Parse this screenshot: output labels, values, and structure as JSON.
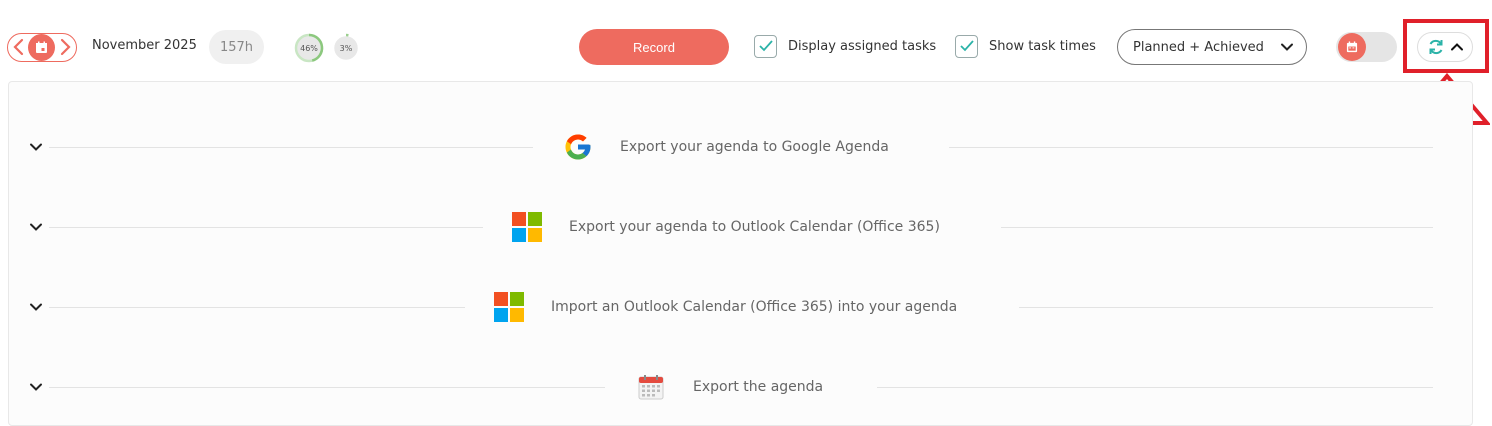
{
  "header": {
    "month": "November 2025",
    "hours": "157h",
    "progress": [
      {
        "label": "46%",
        "value": 46
      },
      {
        "label": "3%",
        "value": 3
      }
    ],
    "record_label": "Record",
    "display_assigned_label": "Display assigned tasks",
    "show_times_label": "Show task times",
    "view_select_value": "Planned + Achieved"
  },
  "sections": [
    {
      "label": "Export your agenda to Google Agenda",
      "icon": "google-icon"
    },
    {
      "label": "Export your agenda to Outlook Calendar (Office 365)",
      "icon": "microsoft-icon"
    },
    {
      "label": "Import an Outlook Calendar (Office 365) into your agenda",
      "icon": "microsoft-icon"
    },
    {
      "label": "Export the agenda",
      "icon": "calendar-icon"
    }
  ],
  "colors": {
    "accent": "#ee6b5f",
    "teal": "#2bb3a8",
    "highlight": "#e0202a"
  }
}
